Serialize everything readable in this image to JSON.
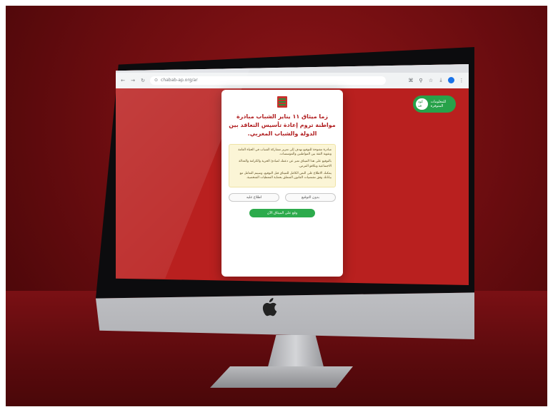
{
  "browser": {
    "nav_back": "←",
    "nav_forward": "→",
    "reload": "↻",
    "url": "chabab-ap.org/ar",
    "icons": [
      "translate-icon",
      "search-icon",
      "star-icon",
      "download-icon",
      "profile-avatar",
      "menu-icon"
    ]
  },
  "pill": {
    "badge": "كود قد",
    "label": "للمعلومات المتوفرة"
  },
  "dialog": {
    "title": "زما ميثاق ١١ يناير الشباب مبادرة مواطنة تروم إعادة تأسيس التعاقد بين الدولة والشباب المغربي.",
    "notes": [
      "مبادرة مفتوحة للتوقيع تهدف إلى تعزيز مشاركة الشباب في الحياة العامة وتقوية الثقة بين المواطنين والمؤسسات.",
      "بالتوقيع على هذا الميثاق تعبر عن دعمك لمبادئ الحرية والكرامة والعدالة الاجتماعية وتكافؤ الفرص.",
      "يمكنك الاطلاع على النص الكامل للميثاق قبل التوقيع، وسيتم التعامل مع بياناتك وفق مقتضيات القانون المتعلق بحماية المعطيات الشخصية."
    ],
    "btn_right": "بدون التوقيع",
    "btn_left": "اطلاع عليه",
    "btn_primary": "وقع على الميثاق الآن"
  },
  "colors": {
    "screen_bg": "#b9201f",
    "title": "#b01d1f",
    "green": "#2cab4c"
  }
}
